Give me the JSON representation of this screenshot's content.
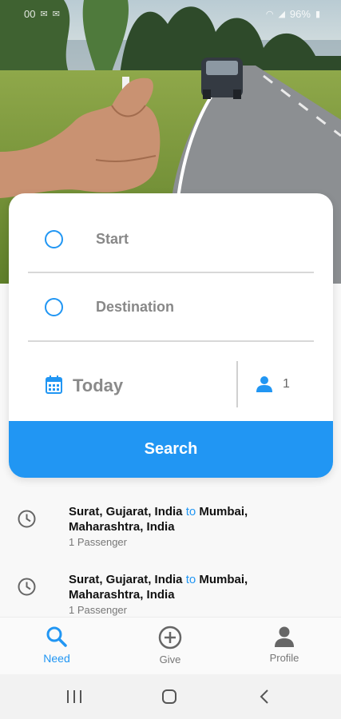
{
  "status_bar": {
    "time": "00",
    "left_icons": [
      "mail-icon",
      "mail-icon"
    ],
    "battery": "96%",
    "right_icons": [
      "wifi-icon",
      "signal-icon",
      "battery-icon"
    ]
  },
  "search_form": {
    "start_label": "Start",
    "destination_label": "Destination",
    "date_label": "Today",
    "passengers": "1",
    "search_label": "Search"
  },
  "recent_searches": [
    {
      "from": "Surat, Gujarat, India",
      "connector": "to",
      "to": "Mumbai, Maharashtra, India",
      "passengers": "1 Passenger"
    },
    {
      "from": "Surat, Gujarat, India",
      "connector": "to",
      "to": "Mumbai, Maharashtra, India",
      "passengers": "1 Passenger"
    }
  ],
  "bottom_nav": {
    "need_label": "Need",
    "give_label": "Give",
    "profile_label": "Profile"
  },
  "colors": {
    "accent": "#2196f3",
    "muted_text": "#888888",
    "nav_inactive": "#777777"
  }
}
